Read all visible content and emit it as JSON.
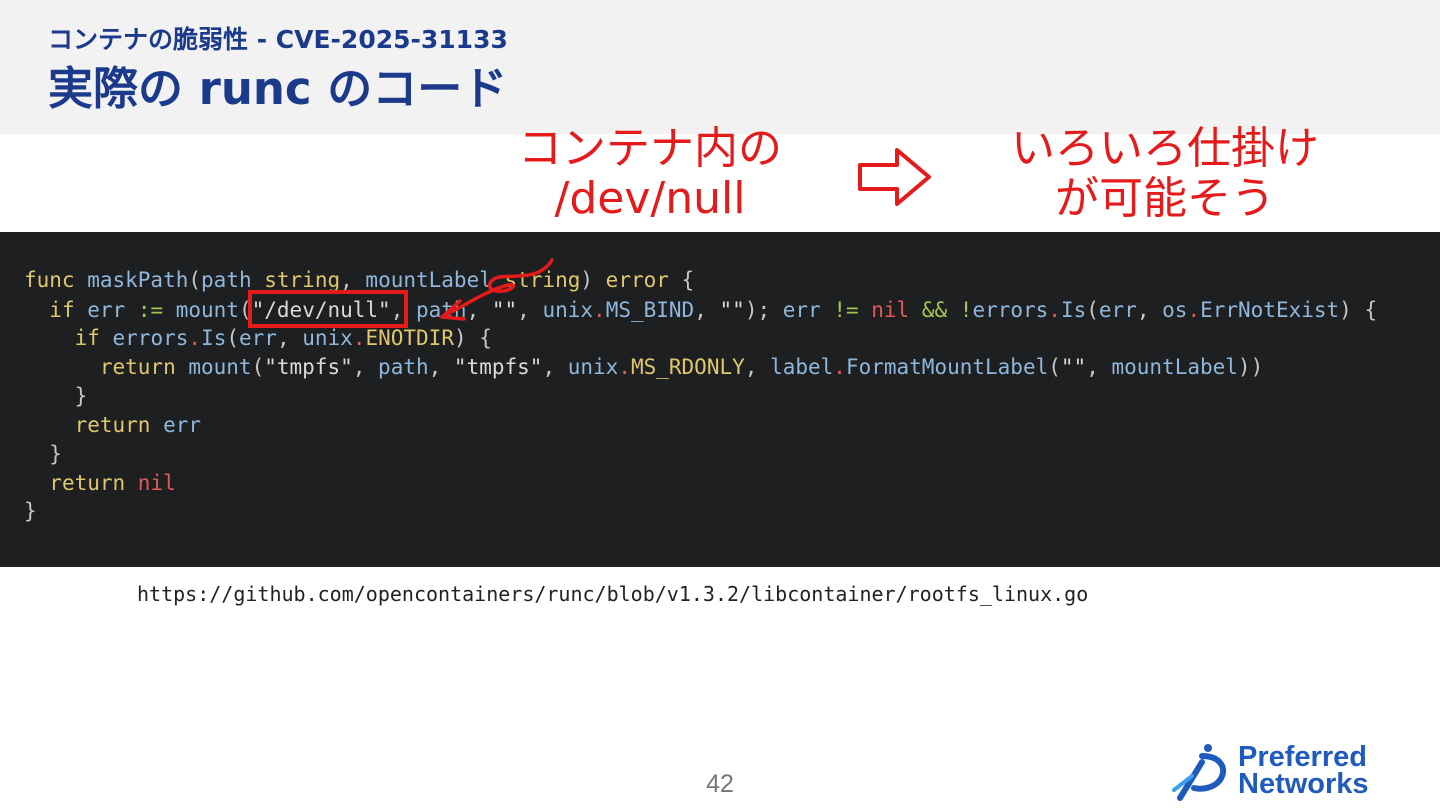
{
  "header": {
    "subtitle": "コンテナの脆弱性 - CVE-2025-31133",
    "title": "実際の runc のコード"
  },
  "annotation": {
    "left_line1": "コンテナ内の",
    "left_line2": "/dev/null",
    "right_line1": "いろいろ仕掛け",
    "right_line2": "が可能そう"
  },
  "code": {
    "line1": {
      "t1": "func",
      "t2": " maskPath",
      "t3": "(",
      "t4": "path",
      "t5": " string",
      "t6": ", ",
      "t7": "mountLabel",
      "t8": " string",
      "t9": ") ",
      "t10": "error",
      "t11": " {"
    },
    "line2": {
      "t1": "if",
      "t2": " err",
      "t3": " := ",
      "t4": "mount",
      "t5": "(",
      "t6": "\"/dev/null\"",
      "t7": ", ",
      "t8": "path",
      "t9": ", ",
      "t10": "\"\"",
      "t11": ", ",
      "t12": "unix",
      "t13": ".",
      "t14": "MS_BIND",
      "t15": ", ",
      "t16": "\"\"",
      "t17": "); ",
      "t18": "err",
      "t19": " != ",
      "t20": "nil",
      "t21": " && ",
      "t22": "!",
      "t23": "errors",
      "t24": ".",
      "t25": "Is",
      "t26": "(",
      "t27": "err",
      "t28": ", ",
      "t29": "os",
      "t30": ".",
      "t31": "ErrNotExist",
      "t32": ") {"
    },
    "line3": {
      "t1": "if",
      "t2": " errors",
      "t3": ".",
      "t4": "Is",
      "t5": "(",
      "t6": "err",
      "t7": ", ",
      "t8": "unix",
      "t9": ".",
      "t10": "ENOTDIR",
      "t11": ") {"
    },
    "line4": {
      "t1": "return",
      "t2": " mount",
      "t3": "(",
      "t4": "\"tmpfs\"",
      "t5": ", ",
      "t6": "path",
      "t7": ", ",
      "t8": "\"tmpfs\"",
      "t9": ", ",
      "t10": "unix",
      "t11": ".",
      "t12": "MS_RDONLY",
      "t13": ", ",
      "t14": "label",
      "t15": ".",
      "t16": "FormatMountLabel",
      "t17": "(",
      "t18": "\"\"",
      "t19": ", ",
      "t20": "mountLabel",
      "t21": "))"
    },
    "line5": {
      "t1": "}"
    },
    "line6": {
      "t1": "return",
      "t2": " err"
    },
    "line7": {
      "t1": "}"
    },
    "line8": {
      "t1": "return",
      "t2": " nil"
    },
    "line9": {
      "t1": "}"
    }
  },
  "source_url": "https://github.com/opencontainers/runc/blob/v1.3.2/libcontainer/rootfs_linux.go",
  "page_number": "42",
  "logo": {
    "line1": "Preferred",
    "line2": "Networks"
  },
  "colors": {
    "title_blue": "#1b3a8c",
    "annotation_red": "#e51a1a",
    "code_background": "#1d1f21",
    "logo_blue": "#1f5bbf"
  },
  "icons": [
    "right-arrow-icon",
    "handwritten-arrow-icon",
    "preferred-networks-logo-icon"
  ]
}
